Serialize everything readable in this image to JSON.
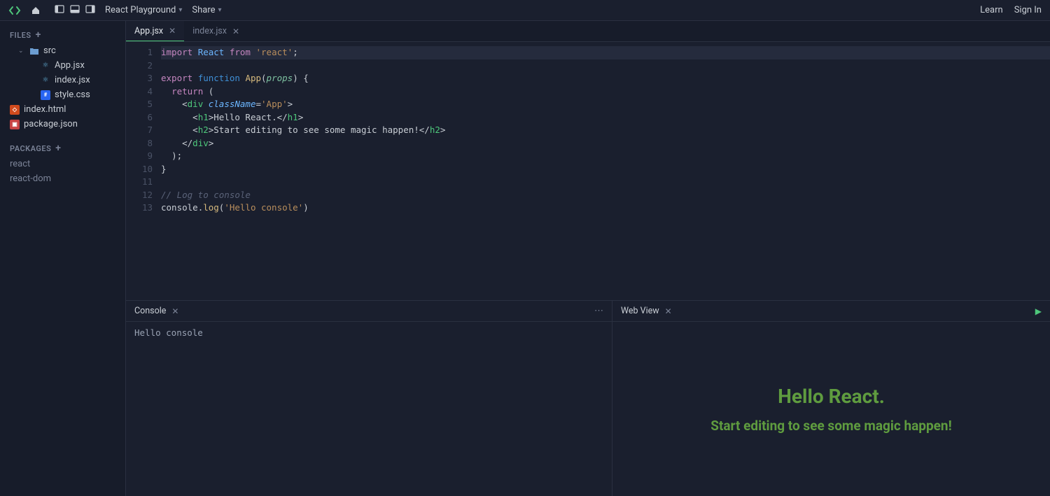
{
  "topbar": {
    "playground_label": "React Playground",
    "share_label": "Share",
    "learn_label": "Learn",
    "signin_label": "Sign In"
  },
  "sidebar": {
    "files_header": "FILES",
    "packages_header": "PACKAGES",
    "tree": {
      "src": "src",
      "app_jsx": "App.jsx",
      "index_jsx": "index.jsx",
      "style_css": "style.css",
      "index_html": "index.html",
      "package_json": "package.json"
    },
    "packages": [
      "react",
      "react-dom"
    ]
  },
  "tabs": [
    {
      "label": "App.jsx",
      "active": true
    },
    {
      "label": "index.jsx",
      "active": false
    }
  ],
  "editor": {
    "lines": [
      "1",
      "2",
      "3",
      "4",
      "5",
      "6",
      "7",
      "8",
      "9",
      "10",
      "11",
      "12",
      "13"
    ],
    "code": {
      "l1": {
        "import": "import",
        "react": "React",
        "from": "from",
        "str": "'react'",
        "semi": ";"
      },
      "l3": {
        "export": "export",
        "function": "function",
        "app": "App",
        "lp": "(",
        "props": "props",
        "rp": ")",
        "ob": " {"
      },
      "l4": {
        "return": "return",
        "lp": " ("
      },
      "l5": {
        "lt": "<",
        "div": "div",
        "sp": " ",
        "attr": "className",
        "eq": "=",
        "val": "'App'",
        "gt": ">"
      },
      "l6": {
        "lt": "<",
        "h1": "h1",
        "gt": ">",
        "txt": "Hello React.",
        "lt2": "</",
        "h1b": "h1",
        "gt2": ">"
      },
      "l7": {
        "lt": "<",
        "h2": "h2",
        "gt": ">",
        "txt": "Start editing to see some magic happen!",
        "lt2": "</",
        "h2b": "h2",
        "gt2": ">"
      },
      "l8": {
        "lt": "</",
        "div": "div",
        "gt": ">"
      },
      "l9": {
        "rp": ");"
      },
      "l10": {
        "cb": "}"
      },
      "l12": {
        "comment": "// Log to console"
      },
      "l13": {
        "console": "console",
        "dot": ".",
        "log": "log",
        "lp": "(",
        "str": "'Hello console'",
        "rp": ")"
      }
    }
  },
  "console": {
    "tab_label": "Console",
    "output": "Hello console"
  },
  "webview": {
    "tab_label": "Web View",
    "h1": "Hello React.",
    "h2": "Start editing to see some magic happen!"
  }
}
